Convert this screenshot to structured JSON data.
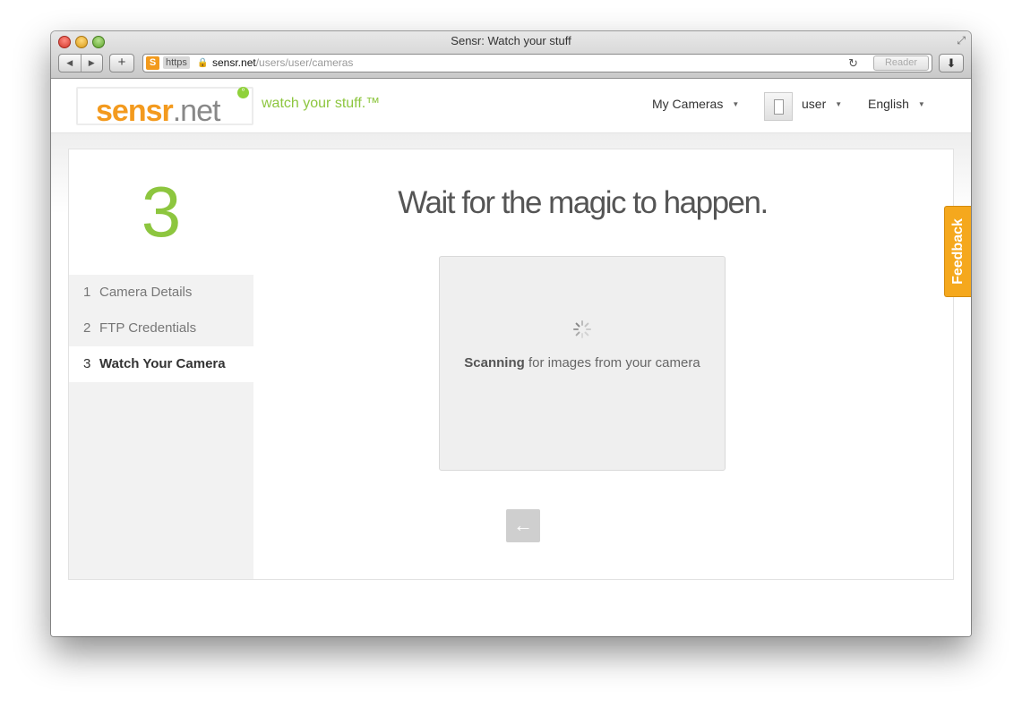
{
  "browser": {
    "title": "Sensr: Watch your stuff",
    "url_scheme": "https",
    "url_domain": "sensr.net",
    "url_path": "/users/user/cameras",
    "reader_label": "Reader",
    "favicon_letter": "S"
  },
  "header": {
    "logo_main": "sensr",
    "logo_suffix": ".net",
    "logo_dot": "°",
    "tagline": "watch your stuff.™",
    "my_cameras": "My Cameras",
    "user": "user",
    "language": "English"
  },
  "sidebar": {
    "big_step": "3",
    "steps": [
      {
        "num": "1",
        "label": "Camera Details"
      },
      {
        "num": "2",
        "label": "FTP Credentials"
      },
      {
        "num": "3",
        "label": "Watch Your Camera"
      }
    ]
  },
  "main": {
    "heading": "Wait for the magic to happen.",
    "scan_bold": "Scanning",
    "scan_rest": " for images from your camera"
  },
  "feedback": {
    "label": "Feedback"
  },
  "colors": {
    "brand_orange": "#f39a1e",
    "brand_green": "#8dc63f"
  }
}
